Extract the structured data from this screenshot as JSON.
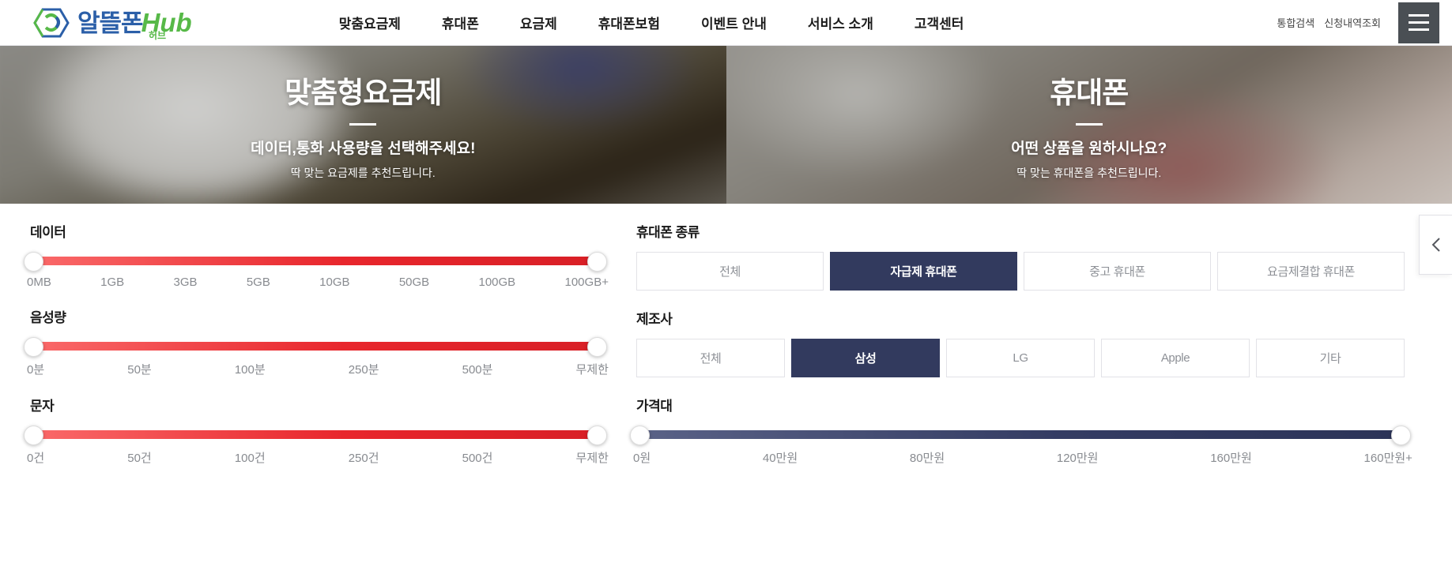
{
  "header": {
    "logo": {
      "kr": "알뜰폰",
      "hub": "Hub",
      "sub": "허브",
      "icon": "hexagon-link-icon"
    },
    "nav": [
      {
        "label": "맞춤요금제"
      },
      {
        "label": "휴대폰"
      },
      {
        "label": "요금제"
      },
      {
        "label": "휴대폰보험"
      },
      {
        "label": "이벤트 안내"
      },
      {
        "label": "서비스 소개"
      },
      {
        "label": "고객센터"
      }
    ],
    "utility": [
      {
        "label": "통합검색"
      },
      {
        "label": "신청내역조회"
      }
    ],
    "menu_icon": "hamburger-menu-icon"
  },
  "hero": {
    "left": {
      "title": "맞춤형요금제",
      "subtitle": "데이터,통화 사용량을 선택해주세요!",
      "caption": "딱 맞는 요금제를 추천드립니다."
    },
    "right": {
      "title": "휴대폰",
      "subtitle": "어떤 상품을 원하시나요?",
      "caption": "딱 맞는 휴대폰을 추천드립니다."
    }
  },
  "filters": {
    "data": {
      "label": "데이터",
      "ticks": [
        "0MB",
        "1GB",
        "3GB",
        "5GB",
        "10GB",
        "50GB",
        "100GB",
        "100GB+"
      ]
    },
    "voice": {
      "label": "음성량",
      "ticks": [
        "0분",
        "50분",
        "100분",
        "250분",
        "500분",
        "무제한"
      ]
    },
    "sms": {
      "label": "문자",
      "ticks": [
        "0건",
        "50건",
        "100건",
        "250건",
        "500건",
        "무제한"
      ]
    },
    "phone_type": {
      "label": "휴대폰 종류",
      "options": [
        {
          "label": "전체",
          "selected": false
        },
        {
          "label": "자급제 휴대폰",
          "selected": true
        },
        {
          "label": "중고 휴대폰",
          "selected": false
        },
        {
          "label": "요금제결합 휴대폰",
          "selected": false
        }
      ]
    },
    "manufacturer": {
      "label": "제조사",
      "options": [
        {
          "label": "전체",
          "selected": false
        },
        {
          "label": "삼성",
          "selected": true
        },
        {
          "label": "LG",
          "selected": false
        },
        {
          "label": "Apple",
          "selected": false
        },
        {
          "label": "기타",
          "selected": false
        }
      ]
    },
    "price": {
      "label": "가격대",
      "ticks": [
        "0원",
        "40만원",
        "80만원",
        "120만원",
        "160만원",
        "160만원+"
      ]
    }
  },
  "collapse": {
    "icon": "chevron-left-icon"
  },
  "colors": {
    "brand_blue": "#2b5fa8",
    "brand_green": "#57b948",
    "slider_red": "#e8262c",
    "selected_navy": "#323a5e",
    "hamburger_gray": "#4a4f54"
  }
}
